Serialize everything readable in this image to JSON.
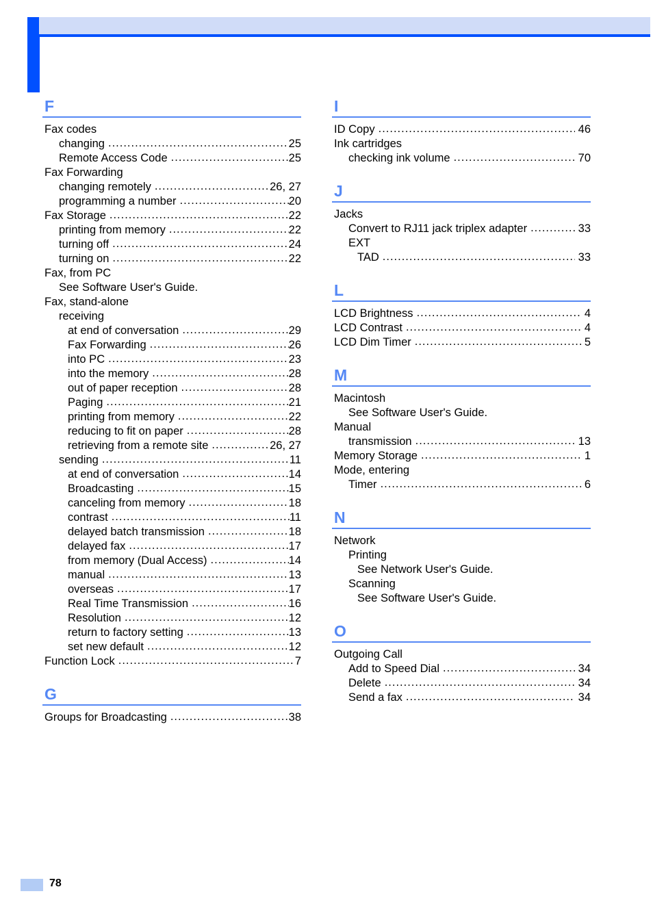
{
  "page": {
    "number": "78"
  },
  "columns": [
    {
      "id": "column-left",
      "sections": [
        {
          "letter": "F",
          "entries": [
            {
              "label": "Fax codes",
              "pages": "",
              "level": 0,
              "leader": false
            },
            {
              "label": "changing",
              "pages": "25",
              "level": 1,
              "leader": true
            },
            {
              "label": "Remote Access Code",
              "pages": "25",
              "level": 1,
              "leader": true
            },
            {
              "label": "Fax Forwarding",
              "pages": "",
              "level": 0,
              "leader": false
            },
            {
              "label": "changing remotely",
              "pages": "26, 27",
              "level": 1,
              "leader": true
            },
            {
              "label": "programming a number",
              "pages": "20",
              "level": 1,
              "leader": true
            },
            {
              "label": "Fax Storage",
              "pages": "22",
              "level": 0,
              "leader": true
            },
            {
              "label": "printing from memory",
              "pages": "22",
              "level": 1,
              "leader": true
            },
            {
              "label": "turning off",
              "pages": "24",
              "level": 1,
              "leader": true
            },
            {
              "label": "turning on",
              "pages": "22",
              "level": 1,
              "leader": true
            },
            {
              "label": "Fax, from PC",
              "pages": "",
              "level": 0,
              "leader": false
            },
            {
              "label": "See Software User's Guide.",
              "pages": "",
              "level": 1,
              "leader": false
            },
            {
              "label": "Fax, stand-alone",
              "pages": "",
              "level": 0,
              "leader": false
            },
            {
              "label": "receiving",
              "pages": "",
              "level": 1,
              "leader": false
            },
            {
              "label": "at end of conversation",
              "pages": "29",
              "level": 2,
              "leader": true
            },
            {
              "label": "Fax Forwarding",
              "pages": "26",
              "level": 2,
              "leader": true
            },
            {
              "label": "into PC",
              "pages": "23",
              "level": 2,
              "leader": true
            },
            {
              "label": "into the memory",
              "pages": "28",
              "level": 2,
              "leader": true
            },
            {
              "label": "out of paper reception",
              "pages": "28",
              "level": 2,
              "leader": true
            },
            {
              "label": "Paging",
              "pages": "21",
              "level": 2,
              "leader": true
            },
            {
              "label": "printing from memory",
              "pages": "22",
              "level": 2,
              "leader": true
            },
            {
              "label": "reducing to fit on paper",
              "pages": "28",
              "level": 2,
              "leader": true
            },
            {
              "label": "retrieving from a remote site",
              "pages": "26, 27",
              "level": 2,
              "leader": true
            },
            {
              "label": "sending",
              "pages": "11",
              "level": 1,
              "leader": true
            },
            {
              "label": "at end of conversation",
              "pages": "14",
              "level": 2,
              "leader": true
            },
            {
              "label": "Broadcasting",
              "pages": "15",
              "level": 2,
              "leader": true
            },
            {
              "label": "canceling from memory",
              "pages": "18",
              "level": 2,
              "leader": true
            },
            {
              "label": "contrast",
              "pages": "11",
              "level": 2,
              "leader": true
            },
            {
              "label": "delayed batch transmission",
              "pages": "18",
              "level": 2,
              "leader": true
            },
            {
              "label": "delayed fax",
              "pages": "17",
              "level": 2,
              "leader": true
            },
            {
              "label": "from memory (Dual Access)",
              "pages": "14",
              "level": 2,
              "leader": true
            },
            {
              "label": "manual",
              "pages": "13",
              "level": 2,
              "leader": true
            },
            {
              "label": "overseas",
              "pages": "17",
              "level": 2,
              "leader": true
            },
            {
              "label": "Real Time Transmission",
              "pages": "16",
              "level": 2,
              "leader": true
            },
            {
              "label": "Resolution",
              "pages": "12",
              "level": 2,
              "leader": true
            },
            {
              "label": "return to factory setting",
              "pages": "13",
              "level": 2,
              "leader": true
            },
            {
              "label": "set new default",
              "pages": "12",
              "level": 2,
              "leader": true
            },
            {
              "label": "Function Lock",
              "pages": "7",
              "level": 0,
              "leader": true
            }
          ]
        },
        {
          "letter": "G",
          "entries": [
            {
              "label": "Groups for Broadcasting",
              "pages": "38",
              "level": 0,
              "leader": true
            }
          ]
        }
      ]
    },
    {
      "id": "column-right",
      "sections": [
        {
          "letter": "I",
          "entries": [
            {
              "label": "ID Copy",
              "pages": "46",
              "level": 0,
              "leader": true
            },
            {
              "label": "Ink cartridges",
              "pages": "",
              "level": 0,
              "leader": false
            },
            {
              "label": "checking ink volume",
              "pages": "70",
              "level": 1,
              "leader": true
            }
          ]
        },
        {
          "letter": "J",
          "entries": [
            {
              "label": "Jacks",
              "pages": "",
              "level": 0,
              "leader": false
            },
            {
              "label": "Convert to RJ11 jack triplex adapter",
              "pages": "33",
              "level": 1,
              "leader": true
            },
            {
              "label": "EXT",
              "pages": "",
              "level": 1,
              "leader": false
            },
            {
              "label": "TAD",
              "pages": "33",
              "level": 2,
              "leader": true
            }
          ]
        },
        {
          "letter": "L",
          "entries": [
            {
              "label": "LCD Brightness",
              "pages": "4",
              "level": 0,
              "leader": true
            },
            {
              "label": "LCD Contrast",
              "pages": "4",
              "level": 0,
              "leader": true
            },
            {
              "label": "LCD Dim Timer",
              "pages": "5",
              "level": 0,
              "leader": true
            }
          ]
        },
        {
          "letter": "M",
          "entries": [
            {
              "label": "Macintosh",
              "pages": "",
              "level": 0,
              "leader": false
            },
            {
              "label": "See Software User's Guide.",
              "pages": "",
              "level": 1,
              "leader": false
            },
            {
              "label": "Manual",
              "pages": "",
              "level": 0,
              "leader": false
            },
            {
              "label": "transmission",
              "pages": "13",
              "level": 1,
              "leader": true
            },
            {
              "label": "Memory Storage",
              "pages": "1",
              "level": 0,
              "leader": true
            },
            {
              "label": "Mode, entering",
              "pages": "",
              "level": 0,
              "leader": false
            },
            {
              "label": "Timer",
              "pages": "6",
              "level": 1,
              "leader": true
            }
          ]
        },
        {
          "letter": "N",
          "entries": [
            {
              "label": "Network",
              "pages": "",
              "level": 0,
              "leader": false
            },
            {
              "label": "Printing",
              "pages": "",
              "level": 1,
              "leader": false
            },
            {
              "label": "See Network User's Guide.",
              "pages": "",
              "level": 2,
              "leader": false
            },
            {
              "label": "Scanning",
              "pages": "",
              "level": 1,
              "leader": false
            },
            {
              "label": "See Software User's Guide.",
              "pages": "",
              "level": 2,
              "leader": false
            }
          ]
        },
        {
          "letter": "O",
          "entries": [
            {
              "label": "Outgoing Call",
              "pages": "",
              "level": 0,
              "leader": false
            },
            {
              "label": "Add to Speed Dial",
              "pages": "34",
              "level": 1,
              "leader": true
            },
            {
              "label": "Delete",
              "pages": "34",
              "level": 1,
              "leader": true
            },
            {
              "label": "Send a fax",
              "pages": "34",
              "level": 1,
              "leader": true
            }
          ]
        }
      ]
    }
  ]
}
